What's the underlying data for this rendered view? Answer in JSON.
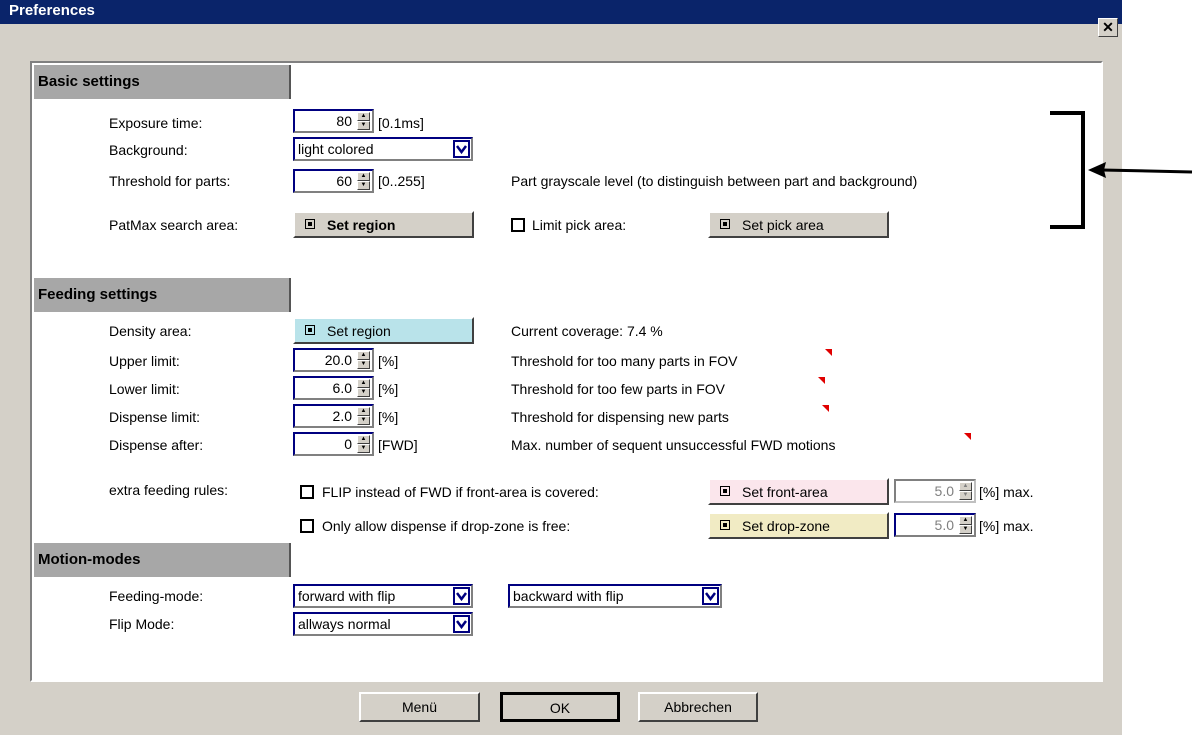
{
  "window": {
    "title": "Preferences",
    "close_glyph": "✕"
  },
  "basic": {
    "heading": "Basic settings",
    "exposure": {
      "label": "Exposure time:",
      "value": "80",
      "unit": "[0.1ms]"
    },
    "background": {
      "label": "Background:",
      "value": "light colored"
    },
    "threshold": {
      "label": "Threshold for parts:",
      "value": "60",
      "unit": "[0..255]",
      "hint": "Part grayscale level  (to distinguish between part and background)"
    },
    "patmax": {
      "label": "PatMax search area:",
      "button": "Set region"
    },
    "limit_pick": {
      "label": "Limit pick area:",
      "button": "Set pick area"
    }
  },
  "feeding": {
    "heading": "Feeding settings",
    "density": {
      "label": "Density area:",
      "button": "Set region",
      "coverage": "Current coverage:  7.4 %"
    },
    "upper": {
      "label": "Upper limit:",
      "value": "20.0",
      "unit": "[%]",
      "hint": "Threshold for too many parts in FOV"
    },
    "lower": {
      "label": "Lower limit:",
      "value": "6.0",
      "unit": "[%]",
      "hint": "Threshold for too few parts in FOV"
    },
    "dispense_limit": {
      "label": "Dispense limit:",
      "value": "2.0",
      "unit": "[%]",
      "hint": "Threshold for dispensing new parts"
    },
    "dispense_after": {
      "label": "Dispense after:",
      "value": "0",
      "unit": "[FWD]",
      "hint": "Max. number of sequent unsuccessful FWD motions"
    },
    "extra": {
      "label": "extra feeding rules:",
      "flip": {
        "label": "FLIP instead of FWD if front-area is covered:",
        "button": "Set front-area",
        "value": "5.0",
        "unit": "[%] max."
      },
      "drop": {
        "label": "Only allow dispense if drop-zone is free:",
        "button": "Set drop-zone",
        "value": "5.0",
        "unit": "[%] max."
      }
    }
  },
  "motion": {
    "heading": "Motion-modes",
    "feeding_mode": {
      "label": "Feeding-mode:",
      "forward": "forward with flip",
      "backward": "backward with flip"
    },
    "flip_mode": {
      "label": "Flip Mode:",
      "value": "allways normal"
    }
  },
  "footer": {
    "menu": "Menü",
    "ok": "OK",
    "cancel": "Abbrechen"
  },
  "colors": {
    "title_bar": "#0a246a",
    "density_button": "#b9e3ea",
    "front_button": "#fbe6ec",
    "drop_button": "#f1ebc4",
    "section_header": "#a7a7a7"
  }
}
